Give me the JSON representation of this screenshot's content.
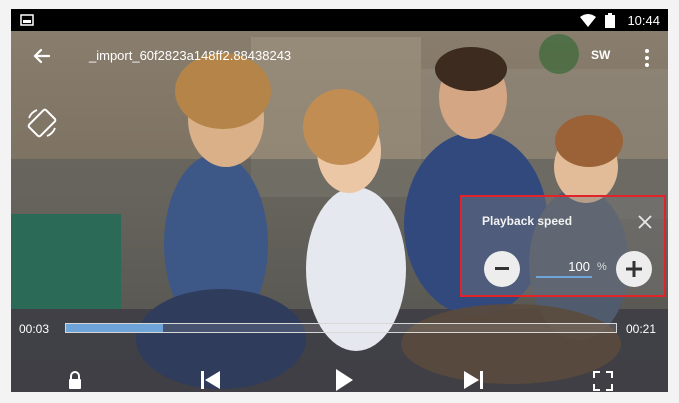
{
  "status_bar": {
    "time": "10:44",
    "icons": [
      "image-icon",
      "wifi-icon",
      "battery-icon"
    ]
  },
  "app_bar": {
    "title": "_import_60f2823a148ff2.88438243",
    "sw_label": "SW",
    "icons": [
      "back-arrow-icon",
      "more-vert-icon"
    ]
  },
  "player": {
    "current_time": "00:03",
    "total_time": "00:21",
    "progress_fraction": 0.176,
    "controls": [
      "lock-icon",
      "skip-previous-icon",
      "play-icon",
      "skip-next-icon",
      "fullscreen-icon"
    ],
    "rotate_icon": "screen-rotation-icon"
  },
  "playback_speed": {
    "title": "Playback speed",
    "value": "100",
    "unit": "%",
    "close_icon": "close-icon",
    "decrement_icon": "minus-icon",
    "increment_icon": "plus-icon"
  },
  "colors": {
    "accent_blue": "#6ea4d8",
    "highlight_red": "#e0242a"
  }
}
